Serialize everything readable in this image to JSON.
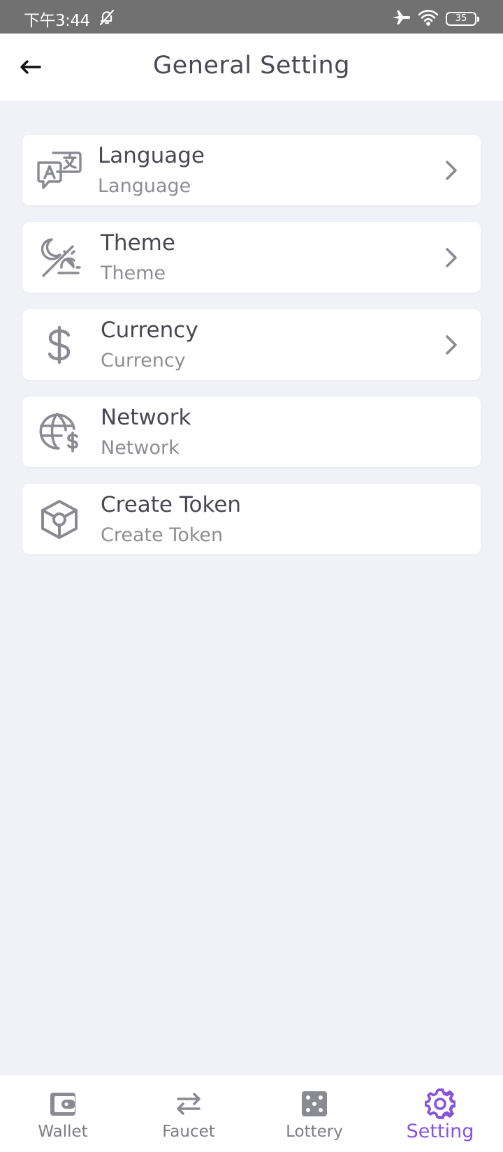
{
  "status_bar": {
    "time": "下午3:44",
    "battery": "35"
  },
  "header": {
    "title": "General Setting"
  },
  "settings": [
    {
      "title": "Language",
      "subtitle": "Language",
      "icon": "translate-icon",
      "has_chevron": true
    },
    {
      "title": "Theme",
      "subtitle": "Theme",
      "icon": "theme-icon",
      "has_chevron": true
    },
    {
      "title": "Currency",
      "subtitle": "Currency",
      "icon": "dollar-icon",
      "has_chevron": true
    },
    {
      "title": "Network",
      "subtitle": "Network",
      "icon": "globe-dollar-icon",
      "has_chevron": false
    },
    {
      "title": "Create Token",
      "subtitle": "Create Token",
      "icon": "cube-icon",
      "has_chevron": false
    }
  ],
  "bottom_nav": [
    {
      "label": "Wallet",
      "icon": "wallet-icon",
      "active": false
    },
    {
      "label": "Faucet",
      "icon": "swap-arrows-icon",
      "active": false
    },
    {
      "label": "Lottery",
      "icon": "dice-icon",
      "active": false
    },
    {
      "label": "Setting",
      "icon": "gear-icon",
      "active": true
    }
  ],
  "colors": {
    "accent": "#8853dd",
    "icon_gray": "#8a8a93",
    "background": "#f1f2f8",
    "status_bar": "#717171"
  }
}
